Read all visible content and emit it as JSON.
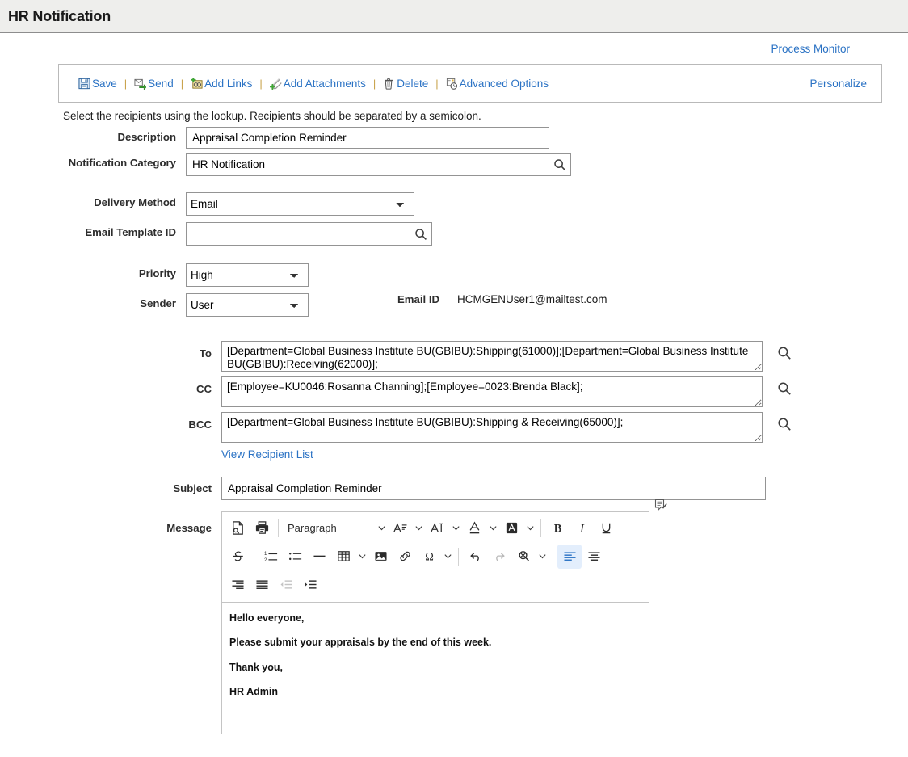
{
  "header": {
    "title": "HR Notification"
  },
  "top_links": {
    "process_monitor": "Process Monitor"
  },
  "toolbar": {
    "actions": [
      {
        "label": "Save",
        "icon": "save-icon"
      },
      {
        "label": "Send",
        "icon": "send-icon"
      },
      {
        "label": "Add Links",
        "icon": "add-links-icon"
      },
      {
        "label": "Add Attachments",
        "icon": "add-attachments-icon"
      },
      {
        "label": "Delete",
        "icon": "delete-icon"
      },
      {
        "label": "Advanced Options",
        "icon": "advanced-options-icon"
      }
    ],
    "separator": "|",
    "personalize": "Personalize"
  },
  "instruction": "Select the recipients using the lookup. Recipients should be separated by a semicolon.",
  "form": {
    "description": {
      "label": "Description",
      "value": "Appraisal Completion Reminder"
    },
    "notification_category": {
      "label": "Notification Category",
      "value": "HR Notification",
      "lookup_icon": "search-icon"
    },
    "delivery_method": {
      "label": "Delivery Method",
      "value": "Email",
      "options": [
        "Email"
      ]
    },
    "email_template_id": {
      "label": "Email Template ID",
      "value": "",
      "lookup_icon": "search-icon"
    },
    "priority": {
      "label": "Priority",
      "value": "High",
      "options": [
        "High"
      ]
    },
    "sender": {
      "label": "Sender",
      "value": "User",
      "options": [
        "User"
      ]
    },
    "email_id": {
      "label": "Email ID",
      "value": "HCMGENUser1@mailtest.com"
    },
    "to": {
      "label": "To",
      "value": "[Department=Global Business Institute BU(GBIBU):Shipping(61000)];[Department=Global Business Institute BU(GBIBU):Receiving(62000)];",
      "lookup_icon": "search-icon"
    },
    "cc": {
      "label": "CC",
      "value": "[Employee=KU0046:Rosanna Channing];[Employee=0023:Brenda Black];",
      "lookup_icon": "search-icon"
    },
    "bcc": {
      "label": "BCC",
      "value": "[Department=Global Business Institute BU(GBIBU):Shipping & Receiving(65000)];",
      "lookup_icon": "search-icon"
    },
    "view_recipient_list": "View Recipient List",
    "subject": {
      "label": "Subject",
      "value": "Appraisal Completion Reminder"
    },
    "message": {
      "label": "Message"
    }
  },
  "editor": {
    "paragraph_style": "Paragraph",
    "tools_row1": [
      "preview-icon",
      "print-icon",
      "paragraph-style-dropdown",
      "font-size-icon",
      "font-family-icon",
      "font-color-icon",
      "background-color-icon",
      "bold-icon",
      "italic-icon",
      "underline-icon"
    ],
    "tools_row2": [
      "strikethrough-icon",
      "numbered-list-icon",
      "bulleted-list-icon",
      "horizontal-rule-icon",
      "table-icon",
      "image-icon",
      "link-icon",
      "special-character-icon",
      "undo-icon",
      "redo-icon",
      "find-replace-icon",
      "align-left-icon",
      "align-center-icon"
    ],
    "tools_row3": [
      "align-right-icon",
      "align-justify-icon",
      "outdent-icon",
      "indent-icon"
    ],
    "spellcheck_icon": "spellcheck-icon",
    "body_paragraphs": [
      "Hello everyone,",
      "Please submit your appraisals by the end of this week.",
      "Thank you,",
      "HR Admin"
    ]
  },
  "colors": {
    "link": "#2a72c4",
    "header_bg": "#eeeeec",
    "separator": "#c8a24a",
    "active_tool_bg": "#e3eefc"
  }
}
